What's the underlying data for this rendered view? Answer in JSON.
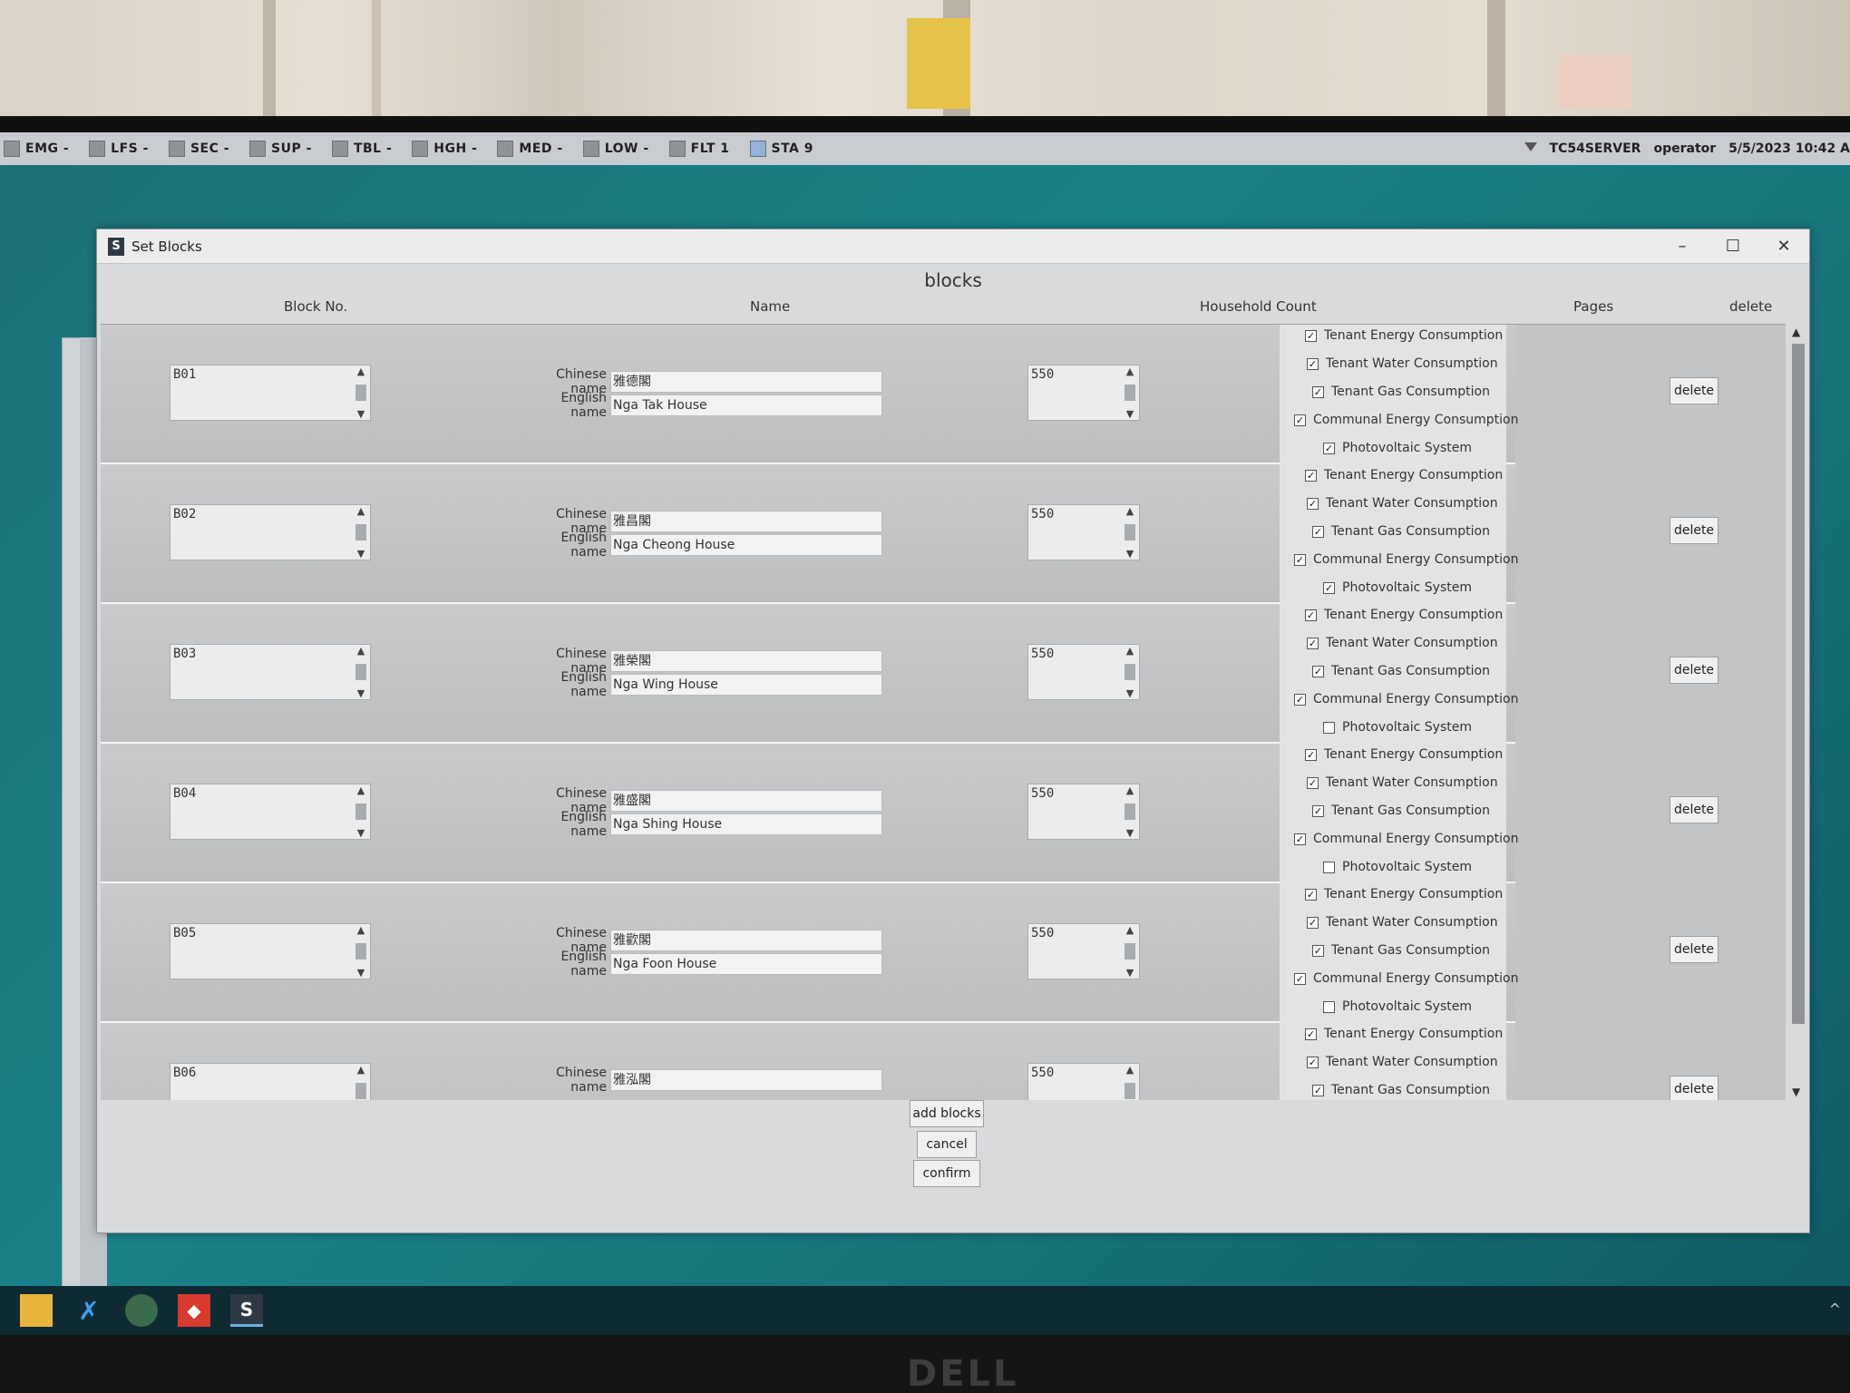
{
  "statusbar": {
    "items": [
      {
        "label": "EMG -"
      },
      {
        "label": "LFS -"
      },
      {
        "label": "SEC -"
      },
      {
        "label": "SUP -"
      },
      {
        "label": "TBL -"
      },
      {
        "label": "HGH -"
      },
      {
        "label": "MED -"
      },
      {
        "label": "LOW -"
      },
      {
        "label": "FLT 1"
      },
      {
        "label": "STA 9"
      }
    ],
    "server": "TC54SERVER",
    "user": "operator",
    "datetime": "5/5/2023 10:42 A"
  },
  "dialog": {
    "title": "Set Blocks",
    "heading": "blocks",
    "columns": {
      "block_no": "Block No.",
      "name": "Name",
      "household_count": "Household Count",
      "pages": "Pages",
      "delete": "delete"
    },
    "chinese_label": "Chinese name",
    "english_label": "English name",
    "delete_label": "delete",
    "check_labels": [
      "Tenant Energy Consumption",
      "Tenant Water Consumption",
      "Tenant Gas Consumption",
      "Communal Energy Consumption",
      "Photovoltaic System"
    ],
    "rows": [
      {
        "block_no": "B01",
        "chinese_name": "雅德閣",
        "english_name": "Nga Tak House",
        "household_count": "550",
        "checks": [
          true,
          true,
          true,
          true,
          true
        ]
      },
      {
        "block_no": "B02",
        "chinese_name": "雅昌閣",
        "english_name": "Nga Cheong House",
        "household_count": "550",
        "checks": [
          true,
          true,
          true,
          true,
          true
        ]
      },
      {
        "block_no": "B03",
        "chinese_name": "雅榮閣",
        "english_name": "Nga Wing House",
        "household_count": "550",
        "checks": [
          true,
          true,
          true,
          true,
          false
        ]
      },
      {
        "block_no": "B04",
        "chinese_name": "雅盛閣",
        "english_name": "Nga Shing House",
        "household_count": "550",
        "checks": [
          true,
          true,
          true,
          true,
          false
        ]
      },
      {
        "block_no": "B05",
        "chinese_name": "雅歡閣",
        "english_name": "Nga Foon House",
        "household_count": "550",
        "checks": [
          true,
          true,
          true,
          true,
          false
        ]
      },
      {
        "block_no": "B06",
        "chinese_name": "雅泓閣",
        "english_name": "",
        "household_count": "550",
        "checks": [
          true,
          true,
          true,
          true,
          false
        ]
      }
    ],
    "buttons": {
      "add_blocks": "add blocks",
      "cancel": "cancel",
      "confirm": "confirm"
    }
  },
  "monitor_brand": "DELL",
  "taskbar": {
    "icons": [
      "file-explorer-icon",
      "vscode-icon",
      "server-manager-icon",
      "git-icon",
      "s-app-icon"
    ]
  }
}
